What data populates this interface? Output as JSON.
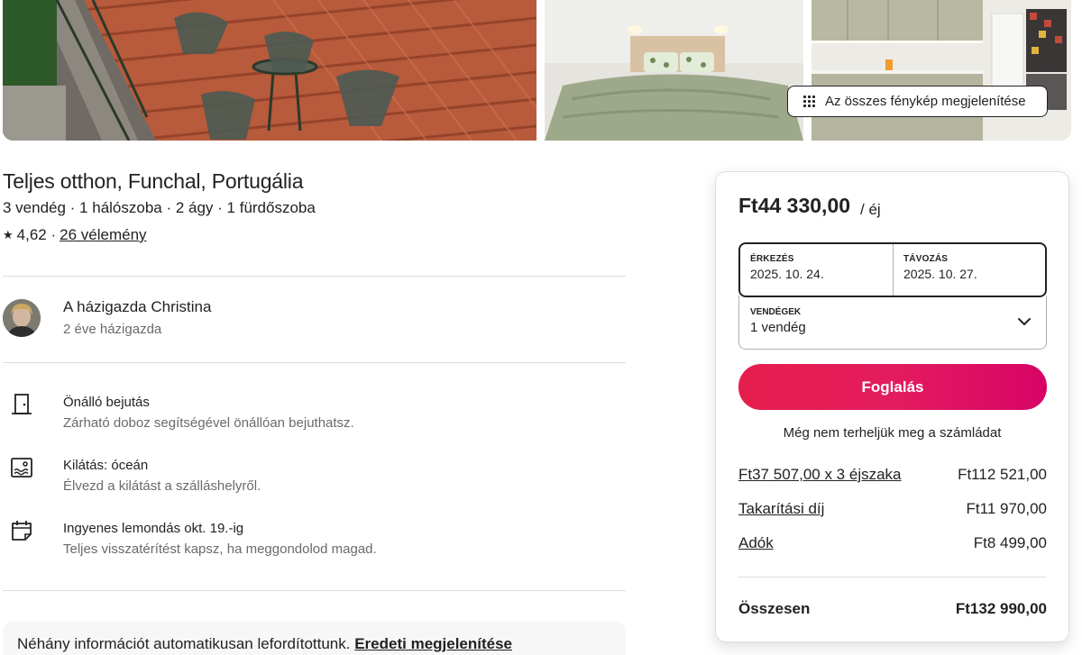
{
  "gallery": {
    "show_all_label": "Az összes fénykép megjelenítése"
  },
  "listing": {
    "title": "Teljes otthon, Funchal, Portugália",
    "subtitle": "3 vendég · 1 hálószoba · 2 ágy · 1 fürdőszoba",
    "rating_star": "★",
    "rating": "4,62 ·",
    "reviews_link": "26 vélemény"
  },
  "host": {
    "name": "A házigazda Christina",
    "since": "2 éve házigazda"
  },
  "features": [
    {
      "icon": "door-icon",
      "title": "Önálló bejutás",
      "desc": "Zárható doboz segítségével önállóan bejuthatsz."
    },
    {
      "icon": "ocean-view-icon",
      "title": "Kilátás: óceán",
      "desc": "Élvezd a kilátást a szálláshelyről."
    },
    {
      "icon": "calendar-icon",
      "title": "Ingyenes lemondás okt. 19.-ig",
      "desc": "Teljes visszatérítést kapsz, ha meggondolod magad."
    }
  ],
  "notice": {
    "text": "Néhány információt automatikusan lefordítottunk.",
    "link": "Eredeti megjelenítése"
  },
  "booking": {
    "price": "Ft44 330,00",
    "per_night": "/ éj",
    "checkin_label": "ÉRKEZÉS",
    "checkin_value": "2025. 10. 24.",
    "checkout_label": "TÁVOZÁS",
    "checkout_value": "2025. 10. 27.",
    "guests_label": "VENDÉGEK",
    "guests_value": "1 vendég",
    "book_button": "Foglalás",
    "no_charge_text": "Még nem terheljük meg a számládat",
    "fees": [
      {
        "label": "Ft37 507,00 x 3 éjszaka",
        "amount": "Ft112 521,00"
      },
      {
        "label": "Takarítási díj",
        "amount": "Ft11 970,00"
      },
      {
        "label": "Adók",
        "amount": "Ft8 499,00"
      }
    ],
    "total_label": "Összesen",
    "total_amount": "Ft132 990,00"
  },
  "colors": {
    "accent": "#e31c5f",
    "text": "#222222",
    "muted": "#6a6a6a",
    "divider": "#dddddd"
  }
}
